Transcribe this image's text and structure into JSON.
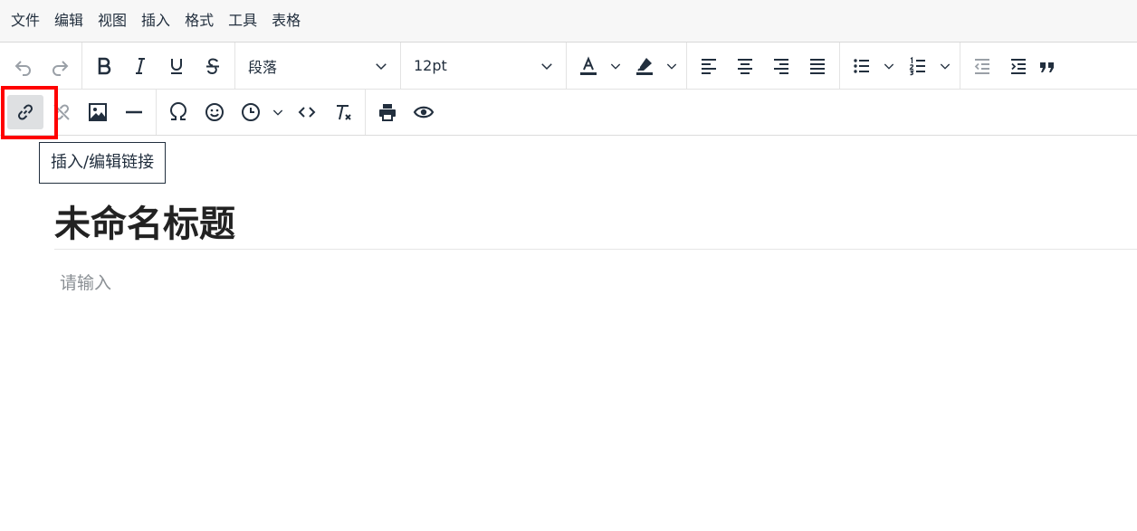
{
  "menubar": {
    "items": [
      "文件",
      "编辑",
      "视图",
      "插入",
      "格式",
      "工具",
      "表格"
    ]
  },
  "toolbar": {
    "block_format": "段落",
    "font_size": "12pt"
  },
  "tooltip": {
    "text": "插入/编辑链接"
  },
  "document": {
    "title": "未命名标题",
    "body_placeholder": "请输入"
  },
  "icons": {
    "undo": "undo-icon",
    "redo": "redo-icon",
    "bold": "bold-icon",
    "italic": "italic-icon",
    "underline": "underline-icon",
    "strikethrough": "strikethrough-icon",
    "link": "link-icon",
    "unlink": "unlink-icon",
    "image": "image-icon",
    "hr": "horizontal-rule-icon",
    "charmap": "omega-icon",
    "emoji": "emoji-icon",
    "datetime": "clock-icon",
    "code": "code-icon",
    "removeformat": "remove-format-icon",
    "print": "print-icon",
    "preview": "eye-icon"
  },
  "colors": {
    "text": "#222f3e",
    "highlight_outline": "#ff0000",
    "active_button": "#dee0e2"
  }
}
